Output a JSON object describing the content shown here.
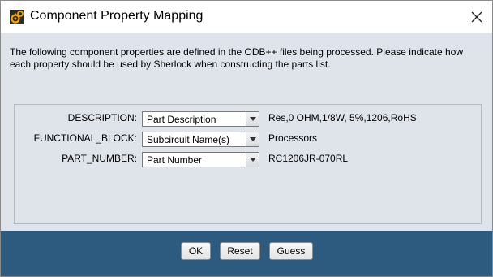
{
  "window": {
    "title": "Component Property Mapping",
    "icon": "sherlock-app-icon",
    "close_icon": "close-icon"
  },
  "message": "The following component properties are defined in the ODB++ files being processed. Please indicate how each property should be used by Sherlock when constructing the parts list.",
  "mappings": [
    {
      "property": "DESCRIPTION:",
      "selected": "Part Description",
      "sample": "Res,0 OHM,1/8W, 5%,1206,RoHS"
    },
    {
      "property": "FUNCTIONAL_BLOCK:",
      "selected": "Subcircuit Name(s)",
      "sample": "Processors"
    },
    {
      "property": "PART_NUMBER:",
      "selected": "Part Number",
      "sample": "RC1206JR-070RL"
    }
  ],
  "buttons": {
    "ok": "OK",
    "reset": "Reset",
    "guess": "Guess"
  },
  "colors": {
    "content_bg": "#dfe3ea",
    "footer_bg": "#2d5b7f",
    "icon_accent": "#f2a900"
  }
}
